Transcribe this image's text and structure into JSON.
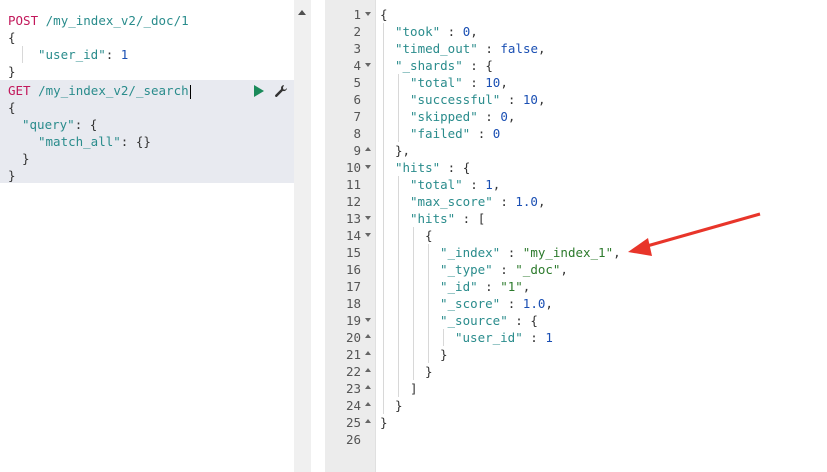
{
  "left_editor": {
    "request1": {
      "method": "POST",
      "path": "/my_index_v2/_doc/1",
      "lines": [
        {
          "open": "{"
        },
        {
          "key": "\"user_id\"",
          "sep": ": ",
          "value": "1"
        },
        {
          "close": "}"
        }
      ]
    },
    "request2": {
      "method": "GET",
      "path": "/my_index_v2/_search",
      "line_open": "{",
      "line_query_key": "\"query\"",
      "line_query_rest": ": {",
      "line_match_key": "\"match_all\"",
      "line_match_rest": ": {}",
      "line_inner_close": "}",
      "line_close": "}",
      "play_icon": "play-icon",
      "wrench_icon": "wrench-icon"
    }
  },
  "response": {
    "line_numbers": [
      "1",
      "2",
      "3",
      "4",
      "5",
      "6",
      "7",
      "8",
      "9",
      "10",
      "11",
      "12",
      "13",
      "14",
      "15",
      "16",
      "17",
      "18",
      "19",
      "20",
      "21",
      "22",
      "23",
      "24",
      "25",
      "26"
    ],
    "lines": [
      {
        "indent": 0,
        "text": "{"
      },
      {
        "indent": 1,
        "key": "\"took\"",
        "val": "0",
        "vclass": "c-num",
        "end": ","
      },
      {
        "indent": 1,
        "key": "\"timed_out\"",
        "val": "false",
        "vclass": "c-kw",
        "end": ","
      },
      {
        "indent": 1,
        "key": "\"_shards\"",
        "val": "{",
        "vclass": "c-punct",
        "end": ""
      },
      {
        "indent": 2,
        "key": "\"total\"",
        "val": "10",
        "vclass": "c-num",
        "end": ","
      },
      {
        "indent": 2,
        "key": "\"successful\"",
        "val": "10",
        "vclass": "c-num",
        "end": ","
      },
      {
        "indent": 2,
        "key": "\"skipped\"",
        "val": "0",
        "vclass": "c-num",
        "end": ","
      },
      {
        "indent": 2,
        "key": "\"failed\"",
        "val": "0",
        "vclass": "c-num",
        "end": ""
      },
      {
        "indent": 1,
        "text": "},"
      },
      {
        "indent": 1,
        "key": "\"hits\"",
        "val": "{",
        "vclass": "c-punct",
        "end": ""
      },
      {
        "indent": 2,
        "key": "\"total\"",
        "val": "1",
        "vclass": "c-num",
        "end": ","
      },
      {
        "indent": 2,
        "key": "\"max_score\"",
        "val": "1.0",
        "vclass": "c-num",
        "end": ","
      },
      {
        "indent": 2,
        "key": "\"hits\"",
        "val": "[",
        "vclass": "c-punct",
        "end": ""
      },
      {
        "indent": 3,
        "text": "{"
      },
      {
        "indent": 4,
        "key": "\"_index\"",
        "val": "\"my_index_1\"",
        "vclass": "c-str",
        "end": ","
      },
      {
        "indent": 4,
        "key": "\"_type\"",
        "val": "\"_doc\"",
        "vclass": "c-str",
        "end": ","
      },
      {
        "indent": 4,
        "key": "\"_id\"",
        "val": "\"1\"",
        "vclass": "c-str",
        "end": ","
      },
      {
        "indent": 4,
        "key": "\"_score\"",
        "val": "1.0",
        "vclass": "c-num",
        "end": ","
      },
      {
        "indent": 4,
        "key": "\"_source\"",
        "val": "{",
        "vclass": "c-punct",
        "end": ""
      },
      {
        "indent": 5,
        "key": "\"user_id\"",
        "val": "1",
        "vclass": "c-num",
        "end": ""
      },
      {
        "indent": 4,
        "text": "}"
      },
      {
        "indent": 3,
        "text": "}"
      },
      {
        "indent": 2,
        "text": "]"
      },
      {
        "indent": 1,
        "text": "}"
      },
      {
        "indent": 0,
        "text": "}"
      },
      {
        "indent": 0,
        "text": ""
      }
    ],
    "folds": {
      "1": "down",
      "4": "down",
      "9": "up",
      "10": "down",
      "13": "down",
      "14": "down",
      "19": "down",
      "20": "up",
      "21": "up",
      "22": "up",
      "23": "up",
      "24": "up",
      "25": "up"
    }
  },
  "annotation": {
    "arrow_color": "#e8352a",
    "arrow_target_line": "15"
  },
  "colors": {
    "method": "#c2185b",
    "path": "#2a8c8c",
    "key": "#2a8c8c",
    "number": "#1a4fb3",
    "string": "#2c7a2c",
    "active_request_bg": "#e8eaf0",
    "gutter_bg": "#ececec"
  }
}
